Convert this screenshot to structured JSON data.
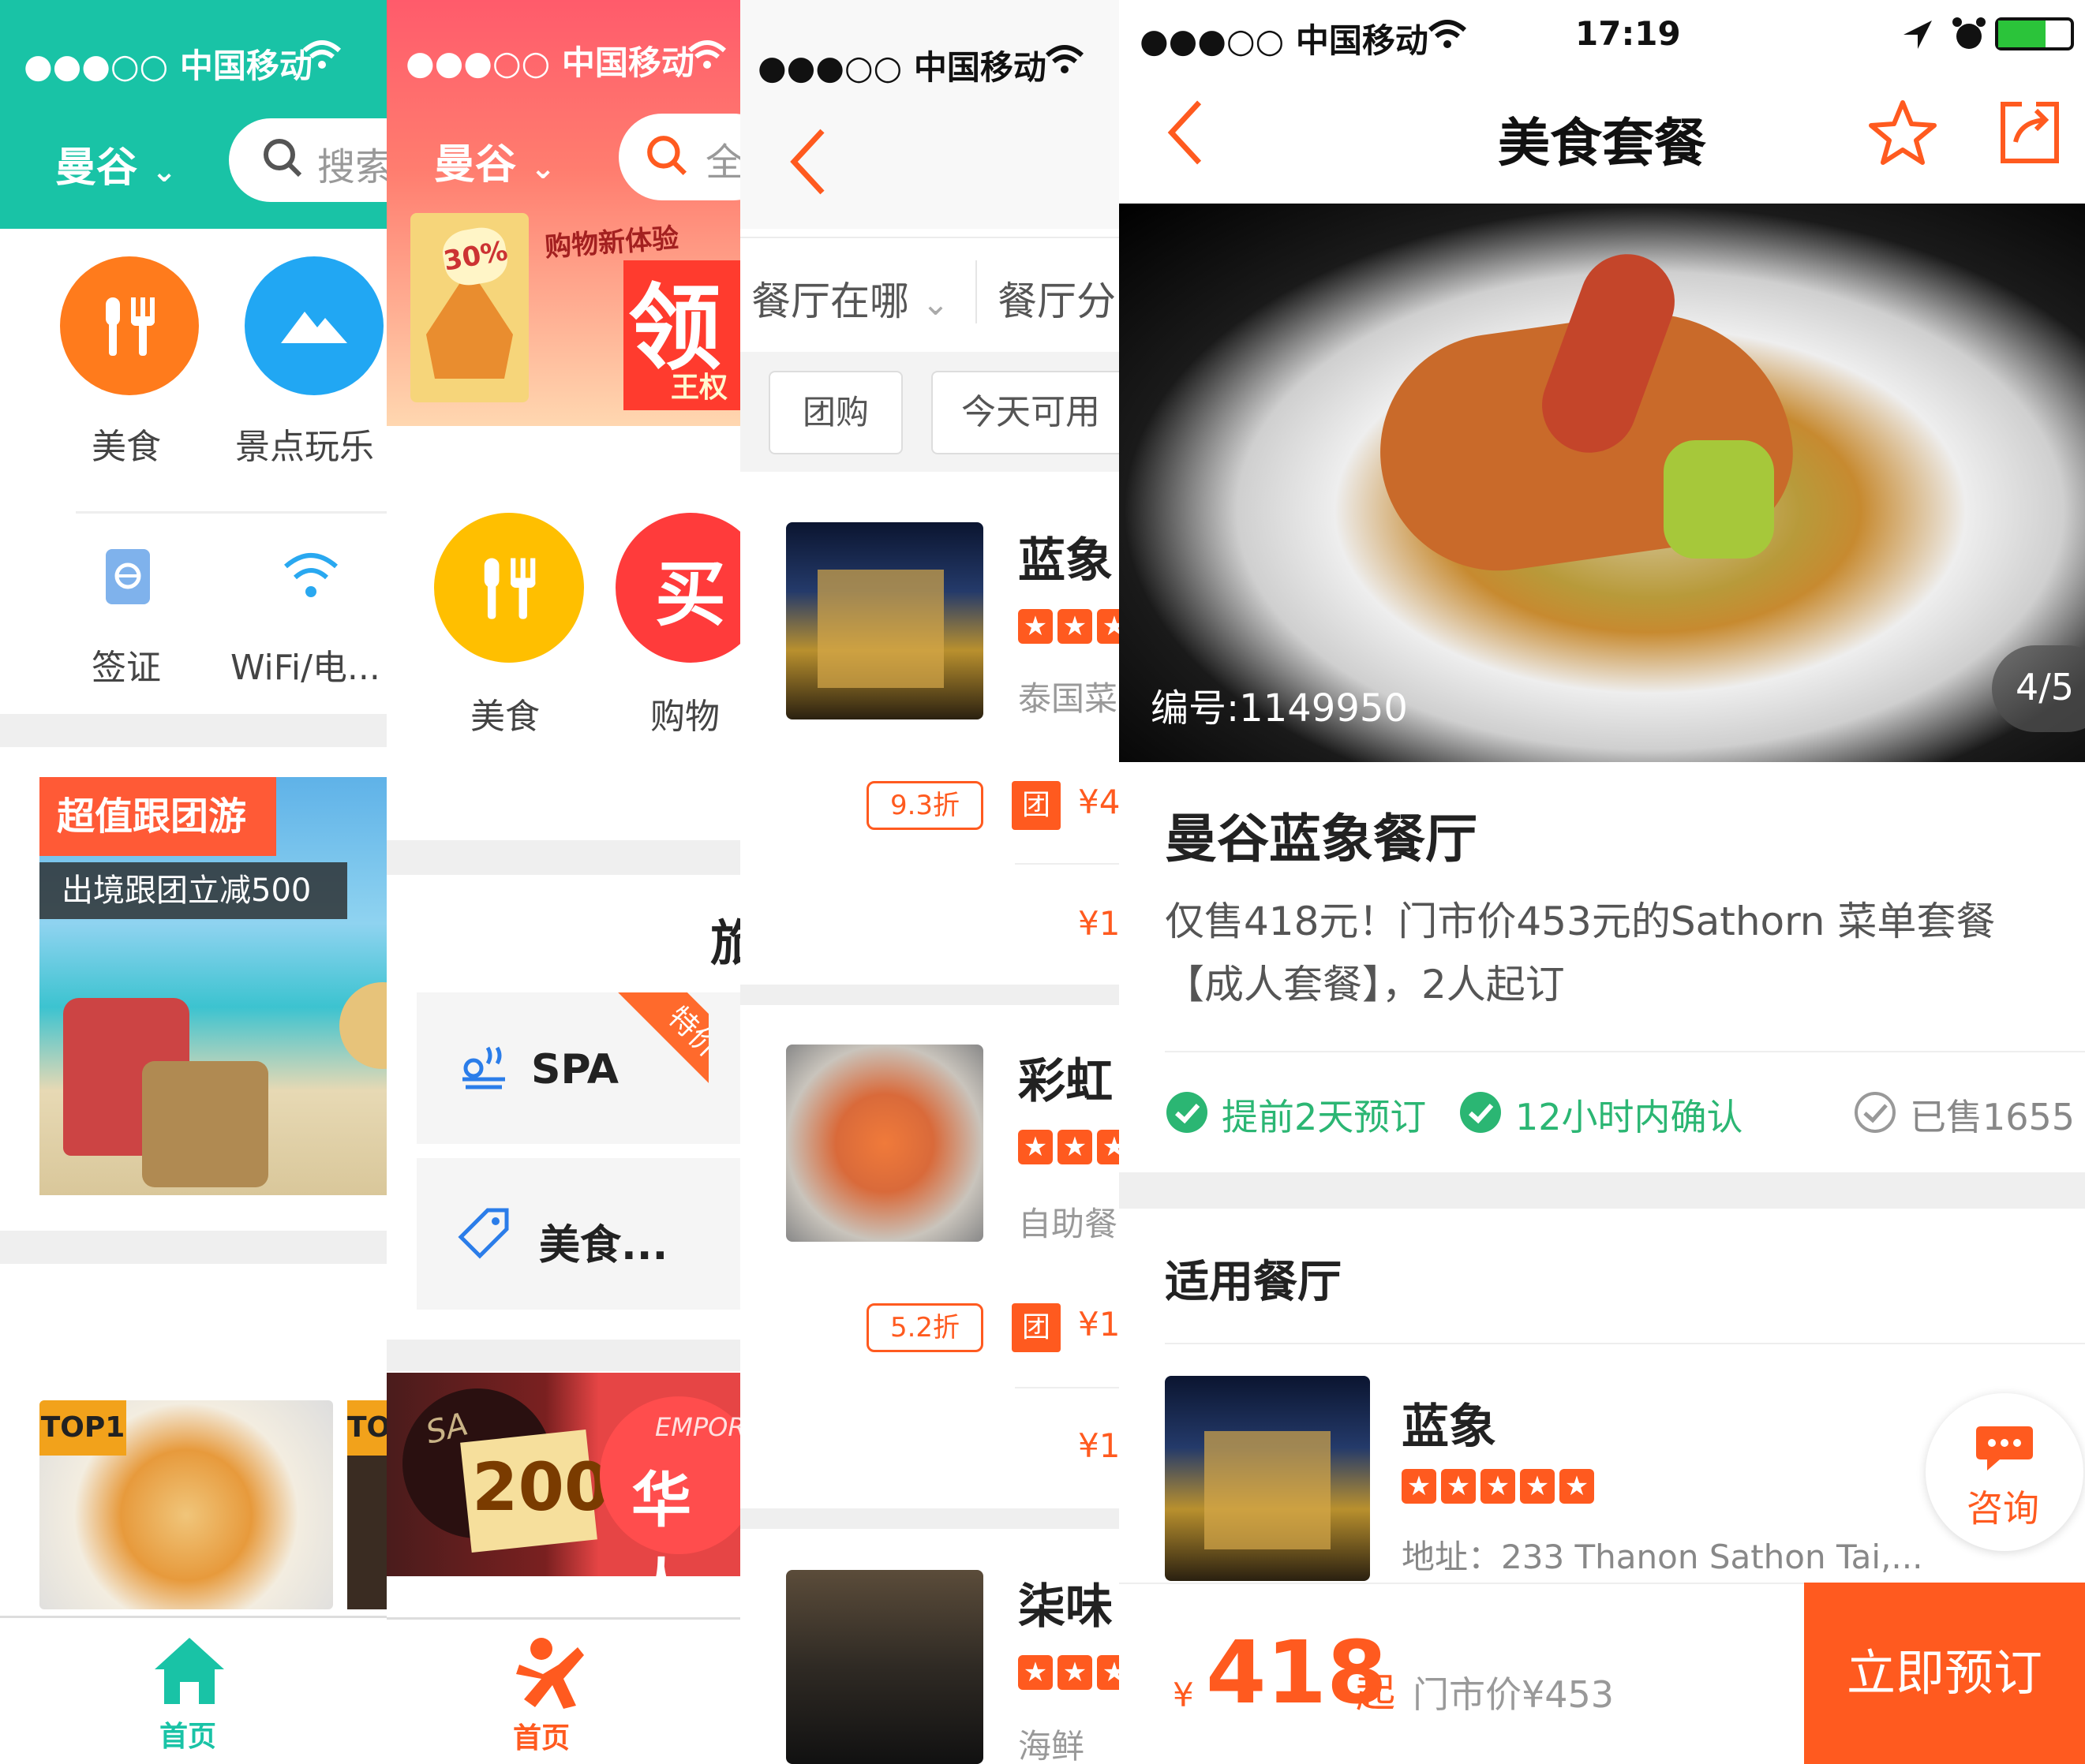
{
  "panel1": {
    "status": "●●●○○ 中国移动",
    "city": "曼谷",
    "search_placeholder": "搜索",
    "categories": [
      {
        "icon": "fork-knife-icon",
        "label": "美食",
        "color": "#ff7b1c"
      },
      {
        "icon": "mountain-icon",
        "label": "景点玩乐",
        "color": "#21a7f3"
      }
    ],
    "small_categories": [
      {
        "icon": "passport-icon",
        "label": "签证"
      },
      {
        "icon": "wifi-icon",
        "label": "WiFi/电..."
      }
    ],
    "promo_title": "超值跟团游",
    "promo_subtitle": "出境跟团立减500",
    "top_badges": [
      "TOP1",
      "TO"
    ],
    "nav_home": "首页",
    "accent": "#19c3a6"
  },
  "panel2": {
    "status": "●●●○○ 中国移动",
    "city": "曼谷",
    "search_placeholder": "全",
    "banner_tag": "30%",
    "banner_text_main": "领",
    "banner_text_top": "购物新体验",
    "banner_text_small": "王权",
    "categories": [
      {
        "icon": "fork-knife-icon",
        "label": "美食"
      },
      {
        "icon": "buy-icon",
        "label": "购物",
        "glyph": "买"
      }
    ],
    "section_title": "旅",
    "cards": [
      {
        "icon": "spa-icon",
        "label": "SPA",
        "badge": "特价"
      },
      {
        "icon": "tag-icon",
        "label": "美食..."
      }
    ],
    "ad_text": "200",
    "ad_text2": "华人",
    "ad_text3": "SA",
    "ad_text4": "EMPOR",
    "nav_home": "首页"
  },
  "panel3": {
    "status": "●●●○○ 中国移动",
    "filters": [
      "餐厅在哪",
      "餐厅分"
    ],
    "tags": [
      "团购",
      "今天可用"
    ],
    "restaurants": [
      {
        "name": "蓝象",
        "sub": "泰国菜",
        "discount": "9.3折",
        "price": "¥4",
        "price2": "¥1"
      },
      {
        "name": "彩虹",
        "sub": "自助餐",
        "discount": "5.2折",
        "price": "¥1",
        "price2": "¥1"
      },
      {
        "name": "柒味",
        "sub": "海鲜"
      }
    ],
    "group_badge": "团"
  },
  "panel4": {
    "status_carrier": "●●●○○ 中国移动",
    "status_time": "17:19",
    "title": "美食套餐",
    "hero_id": "编号:1149950",
    "hero_counter": "4/5",
    "restaurant_title": "曼谷蓝象餐厅",
    "description": "仅售418元！门市价453元的Sathorn 菜单套餐【成人套餐】，2人起订",
    "features": [
      "提前2天预订",
      "12小时内确认"
    ],
    "sold": "已售1655",
    "section": "适用餐厅",
    "venue_name": "蓝象",
    "venue_address": "地址：233 Thanon Sathon Tai,...",
    "consult": "咨询",
    "price_symbol": "¥",
    "price": "418",
    "price_suffix": "起",
    "market_price": "门市价¥453",
    "book": "立即预订",
    "accent": "#ff5a1f",
    "green": "#2bb673"
  }
}
